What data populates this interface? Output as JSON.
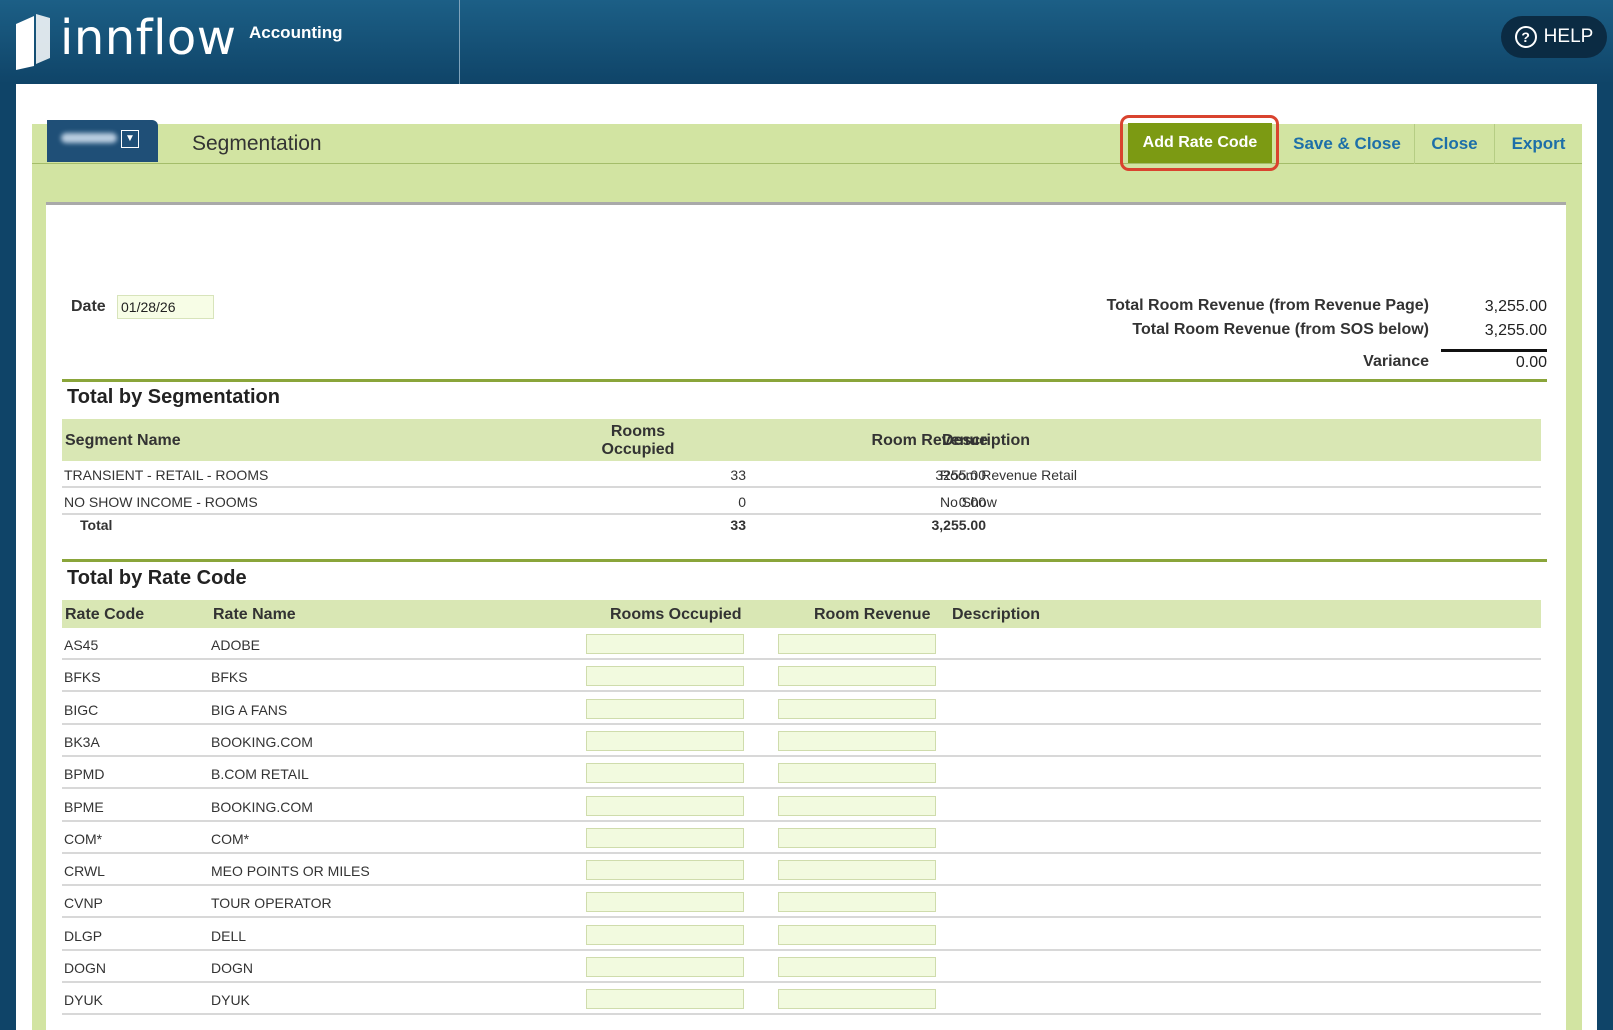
{
  "header": {
    "logo_text": "innflow",
    "module": "Accounting",
    "help_label": "HELP"
  },
  "toolbar": {
    "page_title": "Segmentation",
    "add_rate_code": "Add Rate Code",
    "save_close": "Save & Close",
    "close": "Close",
    "export": "Export"
  },
  "date": {
    "label": "Date",
    "value": "01/28/26"
  },
  "summary": {
    "revenue_page_label": "Total Room Revenue (from Revenue Page)",
    "revenue_page_value": "3,255.00",
    "sos_label": "Total Room Revenue (from SOS below)",
    "sos_value": "3,255.00",
    "variance_label": "Variance",
    "variance_value": "0.00"
  },
  "segmentation": {
    "title": "Total by Segmentation",
    "headers": {
      "segment_name": "Segment Name",
      "rooms_occupied_1": "Rooms",
      "rooms_occupied_2": "Occupied",
      "room_revenue": "Room Revenue",
      "description": "Description"
    },
    "rows": [
      {
        "name": "TRANSIENT - RETAIL - ROOMS",
        "rooms": "33",
        "revenue": "3255.00",
        "description": "Room Revenue Retail"
      },
      {
        "name": "NO SHOW INCOME - ROOMS",
        "rooms": "0",
        "revenue": "0.00",
        "description": "No Show"
      }
    ],
    "total": {
      "label": "Total",
      "rooms": "33",
      "revenue": "3,255.00"
    }
  },
  "rate_codes": {
    "title": "Total by Rate Code",
    "headers": {
      "rate_code": "Rate Code",
      "rate_name": "Rate Name",
      "rooms_occupied": "Rooms Occupied",
      "room_revenue": "Room Revenue",
      "description": "Description"
    },
    "rows": [
      {
        "code": "AS45",
        "name": "ADOBE"
      },
      {
        "code": "BFKS",
        "name": "BFKS"
      },
      {
        "code": "BIGC",
        "name": "BIG A FANS"
      },
      {
        "code": "BK3A",
        "name": "BOOKING.COM"
      },
      {
        "code": "BPMD",
        "name": "B.COM RETAIL"
      },
      {
        "code": "BPME",
        "name": "BOOKING.COM"
      },
      {
        "code": "COM*",
        "name": "COM*"
      },
      {
        "code": "CRWL",
        "name": "MEO POINTS OR MILES"
      },
      {
        "code": "CVNP",
        "name": "TOUR OPERATOR"
      },
      {
        "code": "DLGP",
        "name": "DELL"
      },
      {
        "code": "DOGN",
        "name": "DOGN"
      },
      {
        "code": "DYUK",
        "name": "DYUK"
      }
    ]
  },
  "colors": {
    "header": "#0f4468",
    "panel": "#d2e4a2",
    "accent": "#7c9a13",
    "highlight": "#d9432e",
    "link": "#1d6fa8"
  }
}
